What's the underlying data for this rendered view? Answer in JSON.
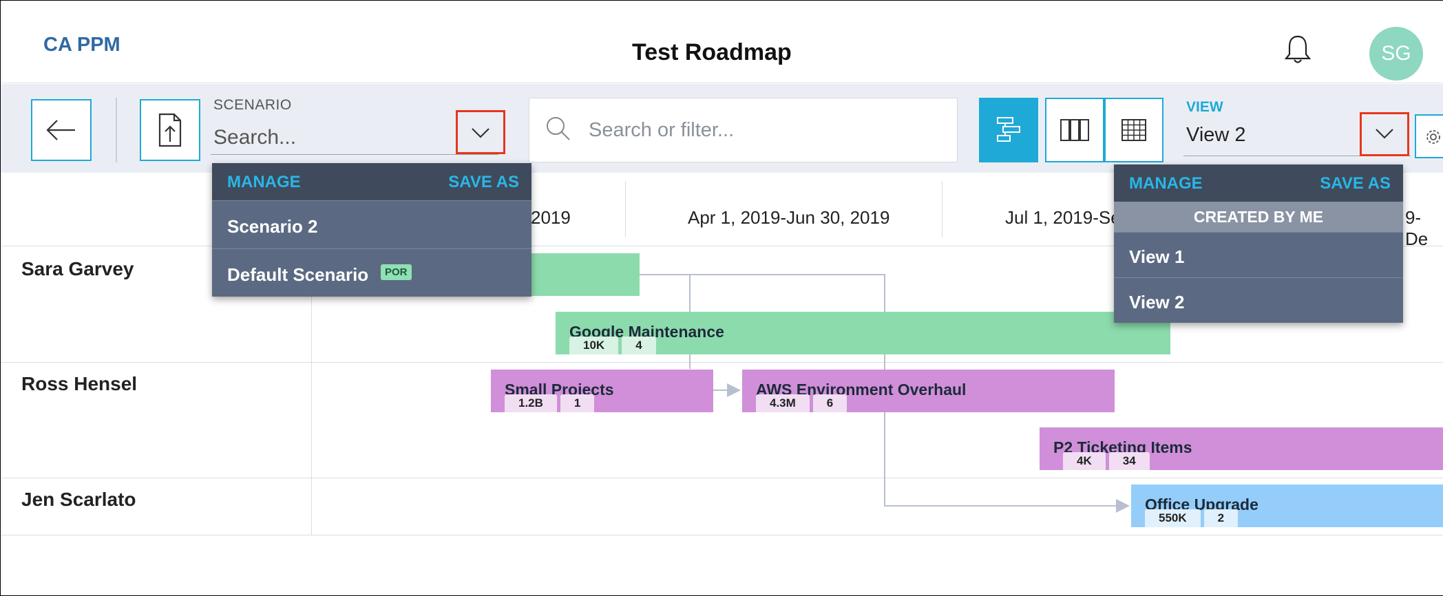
{
  "header": {
    "brand": "CA PPM",
    "title": "Test Roadmap",
    "avatar_initials": "SG"
  },
  "toolbar": {
    "scenario_label": "SCENARIO",
    "scenario_placeholder": "Search...",
    "search_placeholder": "Search or filter...",
    "view_label": "VIEW",
    "view_value": "View 2"
  },
  "timeline": {
    "periods": [
      "2019",
      "Apr 1, 2019-Jun 30, 2019",
      "Jul 1, 2019-Se",
      "9-De"
    ]
  },
  "lanes": [
    {
      "name": "Sara Garvey"
    },
    {
      "name": "Ross Hensel"
    },
    {
      "name": "Jen Scarlato"
    }
  ],
  "items": [
    {
      "label": "",
      "badges": []
    },
    {
      "label": "Google Maintenance",
      "badges": [
        "10K",
        "4"
      ]
    },
    {
      "label": "Small Projects",
      "badges": [
        "1.2B",
        "1"
      ]
    },
    {
      "label": "AWS Environment Overhaul",
      "badges": [
        "4.3M",
        "6"
      ]
    },
    {
      "label": "P2 Ticketing Items",
      "badges": [
        "4K",
        "34"
      ]
    },
    {
      "label": "Office Upgrade",
      "badges": [
        "550K",
        "2"
      ]
    }
  ],
  "scenario_menu": {
    "manage": "MANAGE",
    "save_as": "SAVE AS",
    "items": [
      {
        "label": "Scenario 2"
      },
      {
        "label": "Default Scenario",
        "tag": "POR"
      }
    ]
  },
  "view_menu": {
    "manage": "MANAGE",
    "save_as": "SAVE AS",
    "section": "CREATED BY ME",
    "items": [
      {
        "label": "View 1"
      },
      {
        "label": "View 2"
      }
    ]
  },
  "colors": {
    "accent": "#1ea9d6",
    "brand": "#2f6aa3",
    "highlight": "#e8361e",
    "green_bar": "#8cdbac",
    "purple_bar": "#d08fd8",
    "blue_bar": "#94cdf9"
  }
}
